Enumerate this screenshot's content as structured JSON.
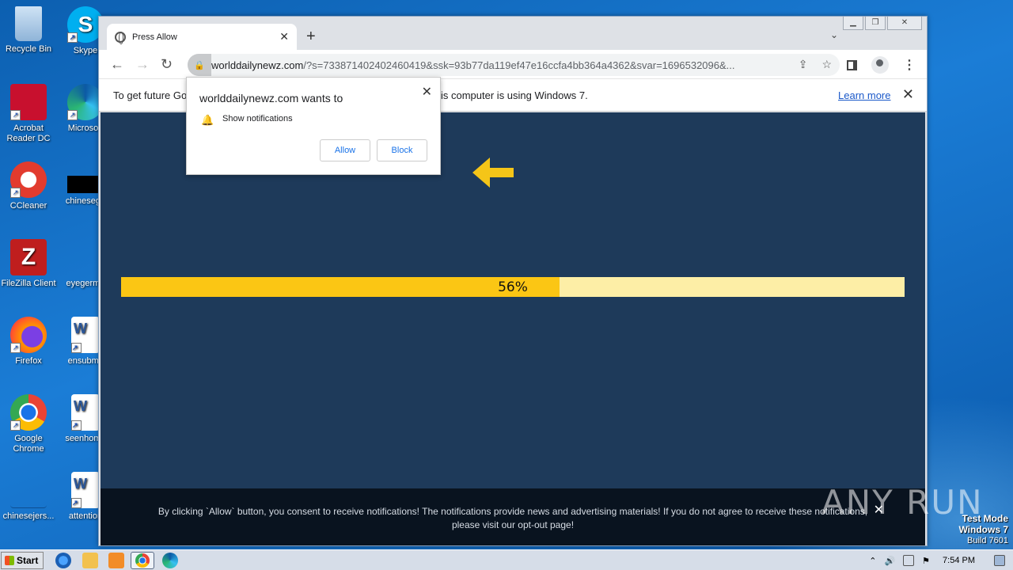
{
  "desktop": {
    "icons": [
      {
        "label": "Recycle Bin"
      },
      {
        "label": "Skype"
      },
      {
        "label": "Acrobat Reader DC"
      },
      {
        "label": "Microsoft"
      },
      {
        "label": "CCleaner"
      },
      {
        "label": "chinesego"
      },
      {
        "label": "FileZilla Client"
      },
      {
        "label": "eyegerma"
      },
      {
        "label": "Firefox"
      },
      {
        "label": "ensubmit"
      },
      {
        "label": "Google Chrome"
      },
      {
        "label": "seenhome"
      },
      {
        "label": "chinesejers..."
      },
      {
        "label": "attention"
      }
    ]
  },
  "browser": {
    "tab_title": "Press Allow",
    "url_host": "worlddailynewz.com",
    "url_path": "/?s=733871402402460419&ssk=93b77da119ef47e16ccfa4bb364a4362&svar=1696532096&...",
    "infobar": {
      "text_left": "To get future Go",
      "text_right": "is computer is using Windows 7.",
      "learn_more": "Learn more"
    }
  },
  "popup": {
    "heading": "worlddailynewz.com wants to",
    "permission": "Show notifications",
    "allow": "Allow",
    "block": "Block"
  },
  "page": {
    "progress_percent": 56,
    "progress_label": "56%",
    "consent_line1": "By clicking `Allow` button, you consent to receive notifications! The notifications provide news and advertising materials! If you do not agree to receive these notifications,",
    "consent_line2": "please visit our opt-out page!",
    "colors": {
      "background": "#1e3a5a",
      "bar_fill": "#fbc614",
      "bar_track": "#fdeea6",
      "arrow": "#f5c518"
    }
  },
  "watermark": "ANY RUN",
  "system": {
    "test_mode": "Test Mode",
    "os": "Windows 7",
    "build": "Build 7601",
    "start": "Start",
    "clock": "7:54 PM"
  }
}
